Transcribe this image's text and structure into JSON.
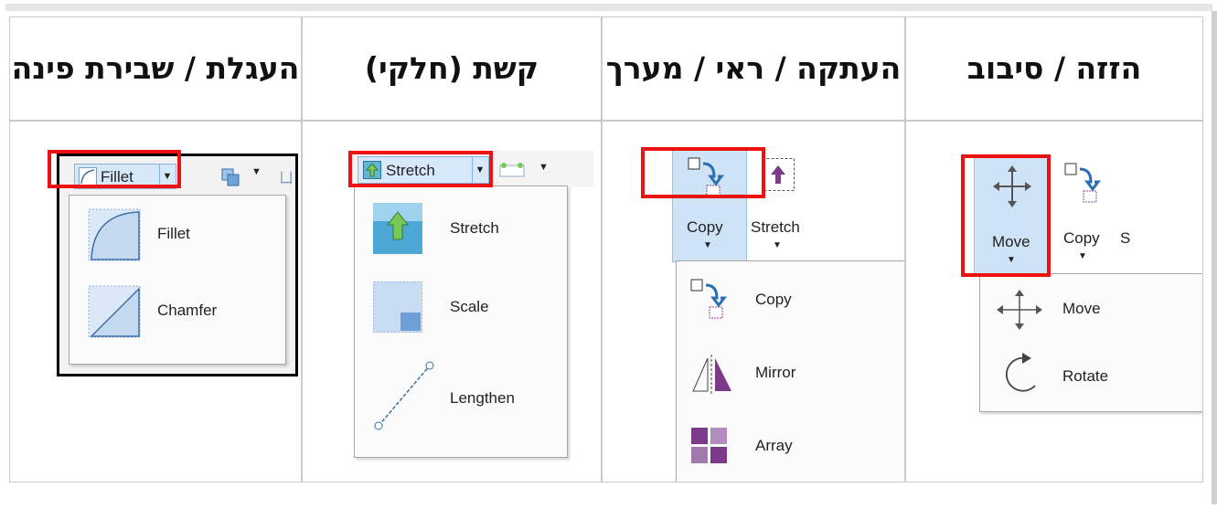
{
  "headers": {
    "fillet": "העגלת / שבירת פינה",
    "stretch": "קשת (חלקי)",
    "copy": "העתקה / ראי / מערך",
    "move": "הזזה / סיבוב"
  },
  "fillet_panel": {
    "button_label": "Fillet",
    "items": [
      "Fillet",
      "Chamfer"
    ]
  },
  "stretch_panel": {
    "button_label": "Stretch",
    "items": [
      "Stretch",
      "Scale",
      "Lengthen"
    ]
  },
  "copy_panel": {
    "copy_label": "Copy",
    "stretch_label": "Stretch",
    "items": [
      "Copy",
      "Mirror",
      "Array"
    ]
  },
  "move_panel": {
    "move_label": "Move",
    "copy_label": "Copy",
    "cut_letter": "S",
    "items": [
      "Move",
      "Rotate"
    ]
  },
  "colors": {
    "highlight": "#ee1111",
    "accent": "#2a6fb5",
    "purple": "#7b3a8a"
  }
}
